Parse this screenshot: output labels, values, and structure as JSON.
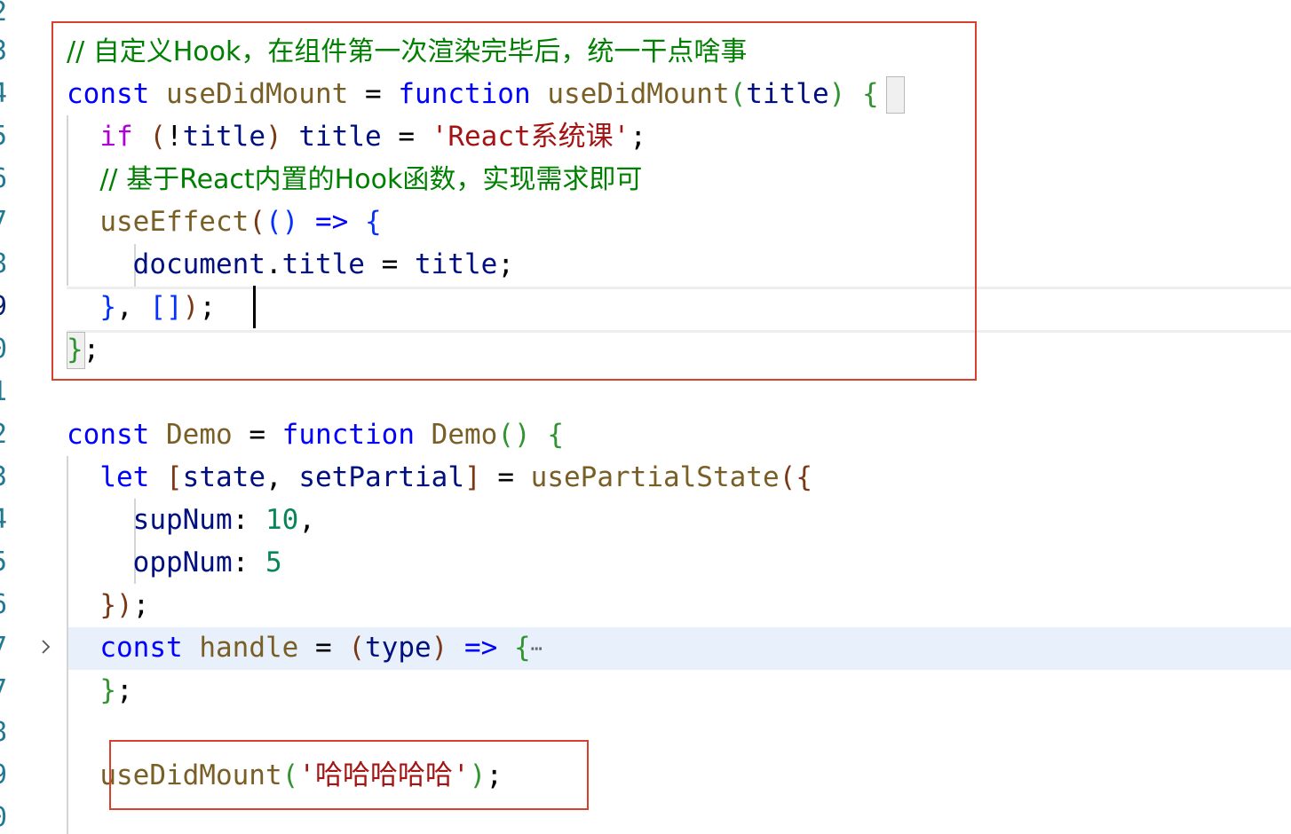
{
  "gutter": {
    "line_numbers": [
      "2",
      "3",
      "4",
      "5",
      "6",
      "7",
      "8",
      "9",
      "0",
      "1",
      "2",
      "3",
      "4",
      "5",
      "6",
      "7",
      "7",
      "8",
      "9",
      "0"
    ]
  },
  "code": {
    "l3_comment": "// 自定义Hook，在组件第一次渲染完毕后，统一干点啥事",
    "l4_const": "const",
    "l4_name": "useDidMount",
    "l4_eq": "=",
    "l4_function": "function",
    "l4_fname": "useDidMount",
    "l4_open_paren": "(",
    "l4_param": "title",
    "l4_close_paren": ")",
    "l4_brace": "{",
    "l5_if": "if",
    "l5_open": "(",
    "l5_not": "!",
    "l5_cond": "title",
    "l5_close": ")",
    "l5_var": "title",
    "l5_eq": "=",
    "l5_str": "'React系统课'",
    "l5_semi": ";",
    "l6_comment": "// 基于React内置的Hook函数，实现需求即可",
    "l7_fn": "useEffect",
    "l7_open": "(",
    "l7_arrow_parens": "()",
    "l7_arrow": "=>",
    "l7_brace": "{",
    "l8_obj": "document",
    "l8_dot": ".",
    "l8_prop": "title",
    "l8_eq": "=",
    "l8_val": "title",
    "l8_semi": ";",
    "l9_brace": "}",
    "l9_comma": ",",
    "l9_deps": "[]",
    "l9_close": ")",
    "l9_semi": ";",
    "l10_brace": "}",
    "l10_semi": ";",
    "l12_const": "const",
    "l12_name": "Demo",
    "l12_eq": "=",
    "l12_function": "function",
    "l12_fname": "Demo",
    "l12_parens": "()",
    "l12_brace": "{",
    "l13_let": "let",
    "l13_open": "[",
    "l13_state": "state",
    "l13_comma": ",",
    "l13_setter": "setPartial",
    "l13_close": "]",
    "l13_eq": "=",
    "l13_fn": "usePartialState",
    "l13_paren": "(",
    "l13_brace": "{",
    "l14_key": "supNum",
    "l14_colon": ":",
    "l14_val": "10",
    "l14_comma": ",",
    "l15_key": "oppNum",
    "l15_colon": ":",
    "l15_val": "5",
    "l16_brace": "}",
    "l16_paren": ")",
    "l16_semi": ";",
    "l17_const": "const",
    "l17_name": "handle",
    "l17_eq": "=",
    "l17_open": "(",
    "l17_param": "type",
    "l17_close": ")",
    "l17_arrow": "=>",
    "l17_brace": "{",
    "l17_fold": "⋯",
    "l18_brace": "}",
    "l18_semi": ";",
    "l20_fn": "useDidMount",
    "l20_open": "(",
    "l20_str": "'哈哈哈哈哈'",
    "l20_close": ")",
    "l20_semi": ";"
  }
}
